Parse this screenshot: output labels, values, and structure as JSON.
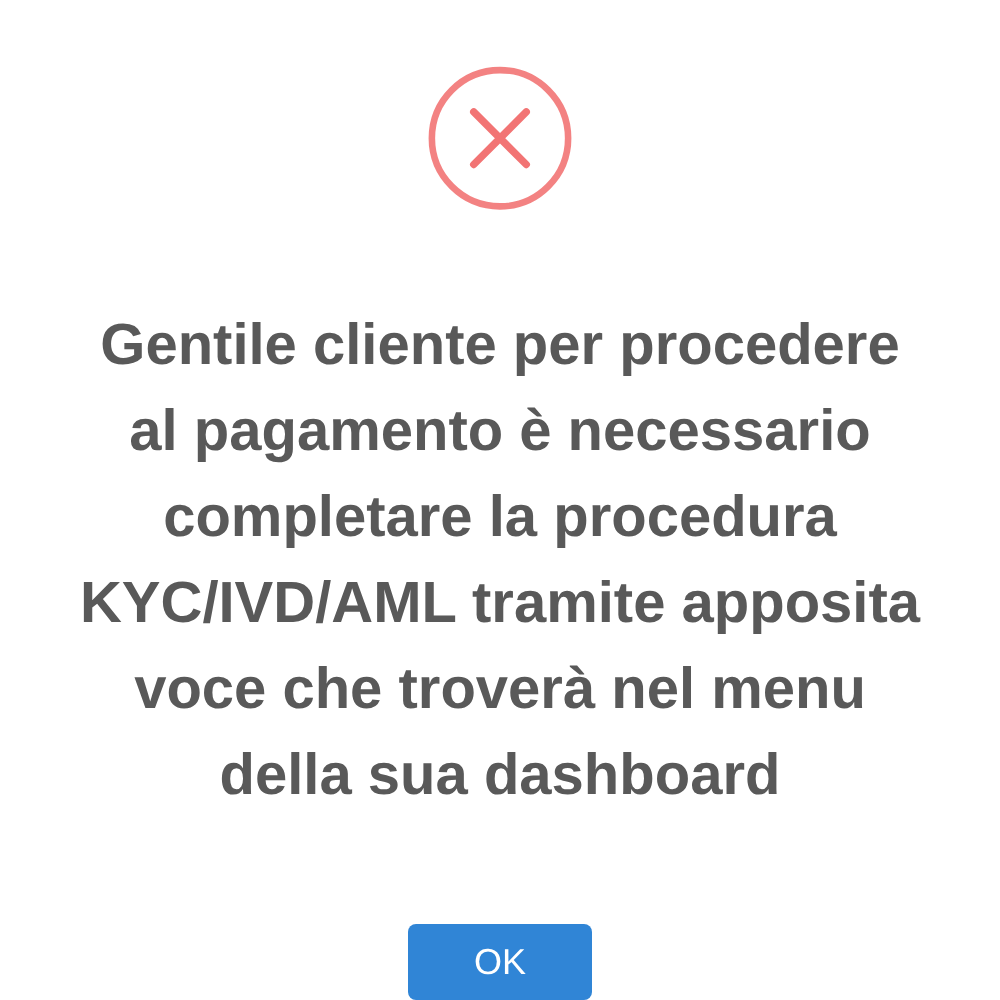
{
  "dialog": {
    "kind": "error",
    "message": "Gentile cliente per procedere al pagamento è necessario completare la procedura KYC/IVD/AML tramite apposita voce che troverà nel menu della sua dashboard",
    "buttons": [
      "OK"
    ]
  }
}
